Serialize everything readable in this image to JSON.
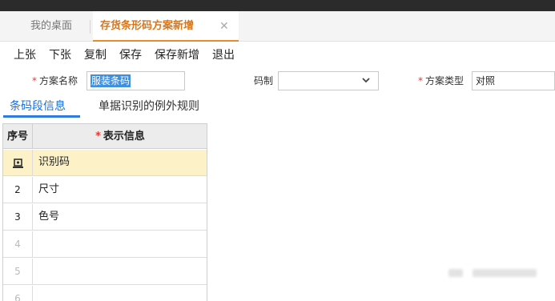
{
  "tabs": {
    "desktop": "我的桌面",
    "active": "存货条形码方案新增",
    "close_glyph": "✕"
  },
  "toolbar": {
    "buttons": [
      "上张",
      "下张",
      "复制",
      "保存",
      "保存新增",
      "退出"
    ]
  },
  "form": {
    "required_mark": "*",
    "name_label": "方案名称",
    "name_value": "服装条码",
    "codec_label": "码制",
    "codec_value": "",
    "type_label": "方案类型",
    "type_value": "对照"
  },
  "subtabs": [
    "条码段信息",
    "单据识别的例外规则"
  ],
  "grid": {
    "headers": {
      "no": "序号",
      "info": "表示信息"
    },
    "rows": [
      {
        "no": "",
        "info": "识别码",
        "icon": "expand-row-icon",
        "selected": true
      },
      {
        "no": "2",
        "info": "尺寸"
      },
      {
        "no": "3",
        "info": "色号"
      },
      {
        "no": "4",
        "info": ""
      },
      {
        "no": "5",
        "info": ""
      },
      {
        "no": "6",
        "info": ""
      }
    ]
  },
  "colors": {
    "accent_orange": "#e88a2e",
    "accent_blue": "#2f7be0",
    "required_red": "#e53935",
    "selected_row": "#fdf1c7"
  }
}
